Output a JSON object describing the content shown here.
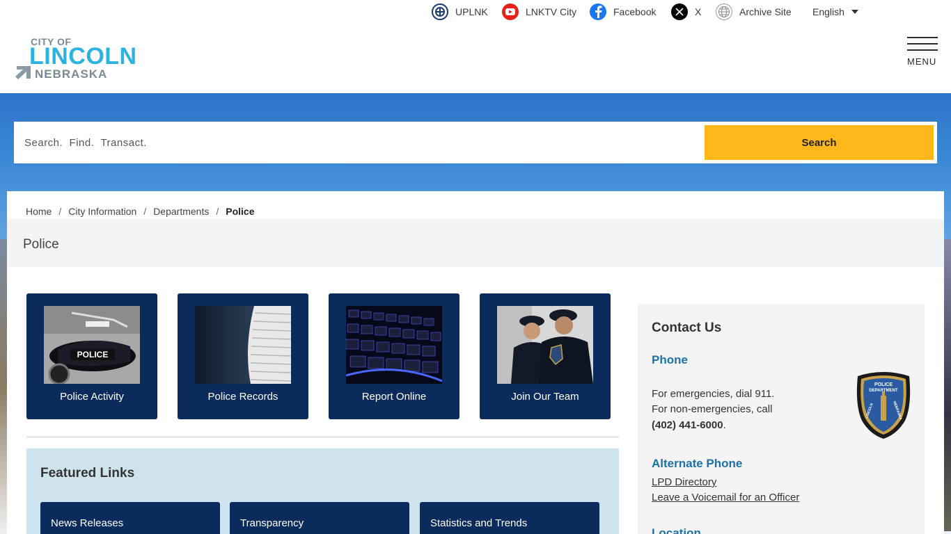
{
  "topbar": {
    "links": [
      {
        "label": "UPLNK",
        "icon": "uplnk-icon"
      },
      {
        "label": "LNKTV City",
        "icon": "youtube-icon"
      },
      {
        "label": "Facebook",
        "icon": "facebook-icon"
      },
      {
        "label": "X",
        "icon": "x-icon"
      },
      {
        "label": "Archive Site",
        "icon": "globe-icon"
      }
    ],
    "language": "English"
  },
  "logo": {
    "line1": "CITY OF",
    "line2": "LINCOLN",
    "line3": "NEBRASKA"
  },
  "menu": {
    "label": "MENU"
  },
  "search": {
    "placeholder": "Search.  Find.  Transact.",
    "button_label": "Search",
    "button_color": "#fdb71a"
  },
  "breadcrumb": {
    "items": [
      "Home",
      "City Information",
      "Departments"
    ],
    "current": "Police"
  },
  "page": {
    "title": "Police"
  },
  "tiles": [
    {
      "label": "Police Activity"
    },
    {
      "label": "Police Records"
    },
    {
      "label": "Report Online"
    },
    {
      "label": "Join Our Team"
    }
  ],
  "featured": {
    "heading": "Featured Links",
    "links": [
      "News Releases",
      "Transparency",
      "Statistics and Trends"
    ]
  },
  "contact": {
    "heading": "Contact Us",
    "phone_heading": "Phone",
    "phone_line1": "For emergencies, dial 911.",
    "phone_line2": "For non-emergencies, call",
    "phone_number": "(402) 441-6000",
    "alt_heading": "Alternate Phone",
    "alt_links": [
      "LPD Directory",
      "Leave a Voicemail for an Officer"
    ],
    "location_heading": "Location",
    "badge_text": [
      "POLICE",
      "DEPARTMENT",
      "LINCOLN",
      "NEBRASKA"
    ]
  },
  "colors": {
    "navy": "#0b2b5c",
    "accent_blue": "#1a72a8",
    "logo_blue": "#2bb3df",
    "search_yellow": "#fdb71a"
  }
}
